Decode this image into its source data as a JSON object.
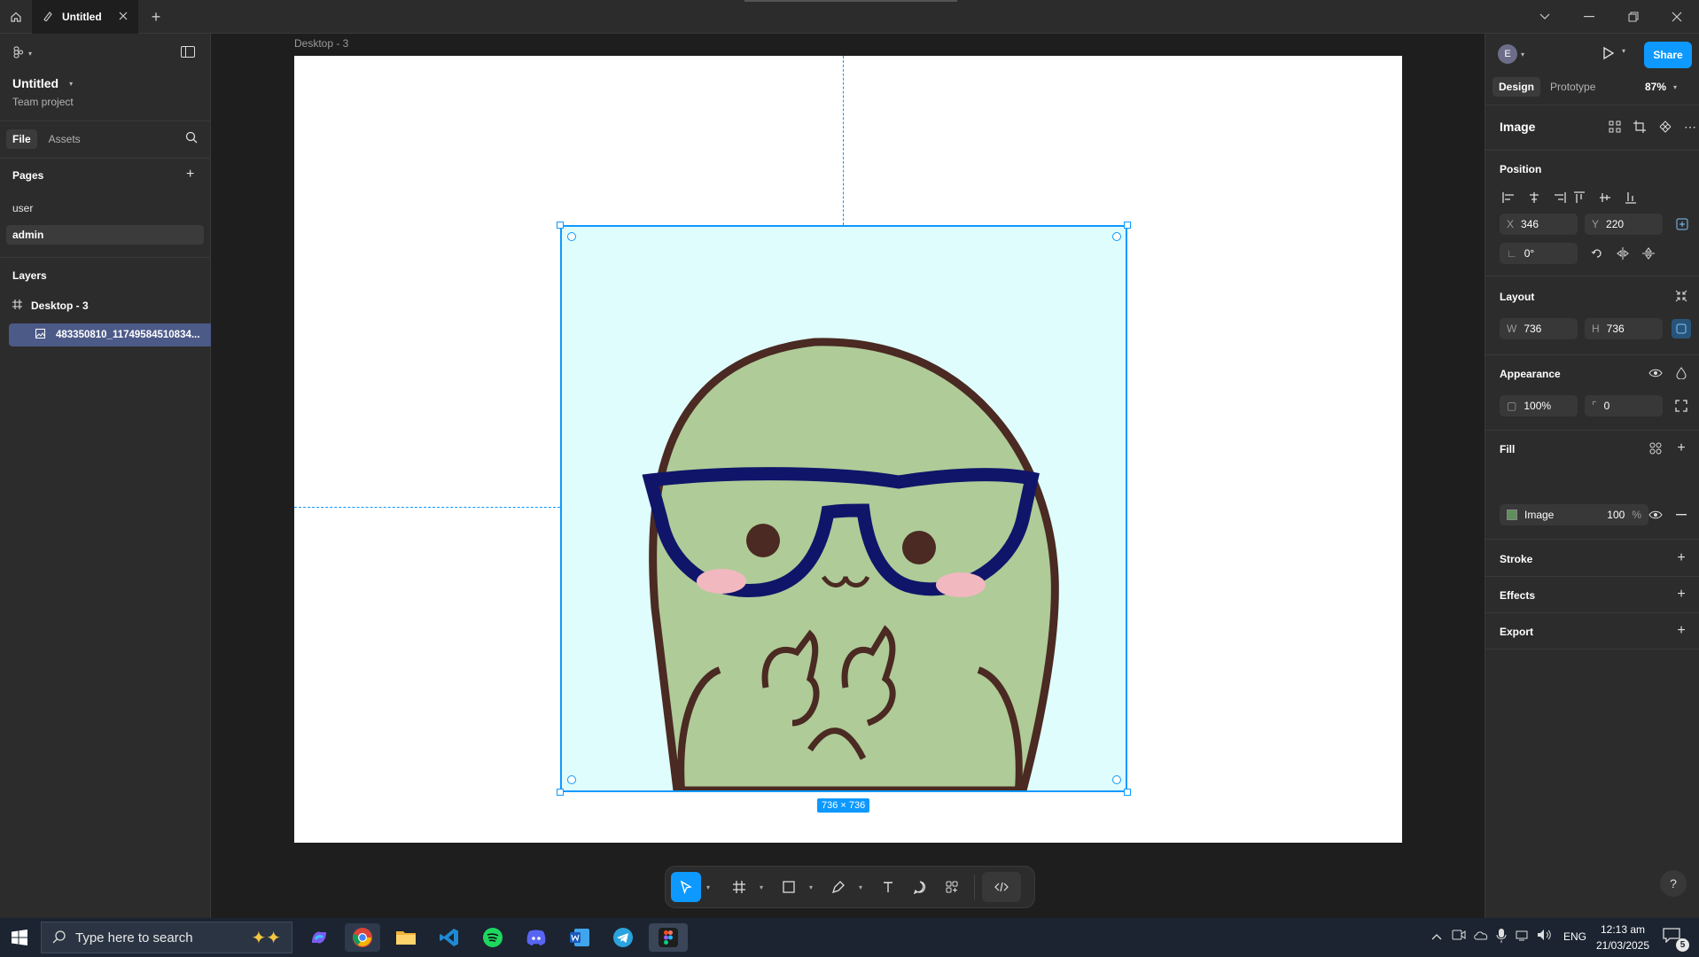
{
  "titlebar": {
    "tab_title": "Untitled",
    "new_tab": "+"
  },
  "left": {
    "project_title": "Untitled",
    "project_subtitle": "Team project",
    "tab_file": "File",
    "tab_assets": "Assets",
    "pages_title": "Pages",
    "pages": [
      {
        "label": "user"
      },
      {
        "label": "admin"
      }
    ],
    "layers_title": "Layers",
    "layers": [
      {
        "label": "Desktop - 3"
      },
      {
        "label": "483350810_11749584510834..."
      }
    ]
  },
  "canvas": {
    "frame_label": "Desktop - 3",
    "size_badge": "736 × 736"
  },
  "right": {
    "avatar_letter": "E",
    "share_label": "Share",
    "tab_design": "Design",
    "tab_prototype": "Prototype",
    "zoom": "87%",
    "selection_title": "Image",
    "position_title": "Position",
    "x_label": "X",
    "x_value": "346",
    "y_label": "Y",
    "y_value": "220",
    "rotation": "0°",
    "layout_title": "Layout",
    "w_label": "W",
    "w_value": "736",
    "h_label": "H",
    "h_value": "736",
    "appearance_title": "Appearance",
    "opacity": "100%",
    "radius": "0",
    "fill_title": "Fill",
    "fill_type": "Image",
    "fill_opacity": "100",
    "fill_unit": "%",
    "stroke_title": "Stroke",
    "effects_title": "Effects",
    "export_title": "Export",
    "help": "?"
  },
  "taskbar": {
    "search_placeholder": "Type here to search",
    "lang": "ENG",
    "time": "12:13 am",
    "date": "21/03/2025",
    "notif_count": "5"
  },
  "colors": {
    "accent": "#0d99ff",
    "image_bg": "#dffdfd",
    "turtle": "#afcb98"
  }
}
